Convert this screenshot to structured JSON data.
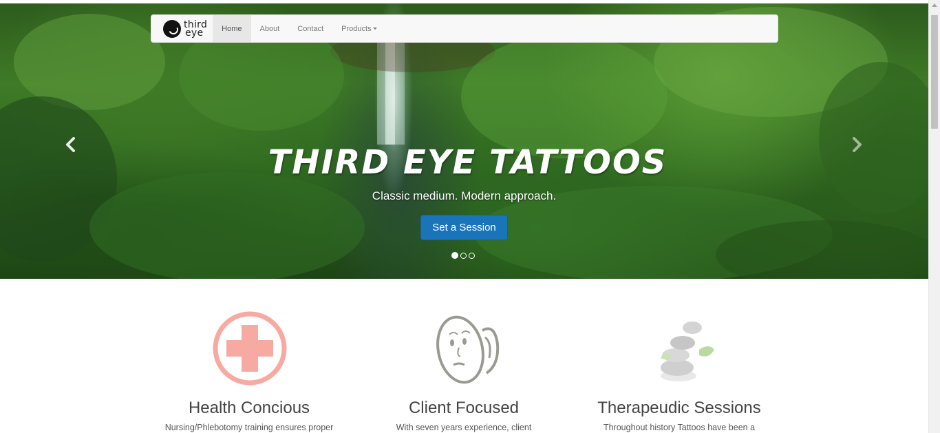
{
  "navbar": {
    "brand_line1": "third",
    "brand_line2": "eye",
    "items": [
      {
        "label": "Home",
        "active": true
      },
      {
        "label": "About",
        "active": false
      },
      {
        "label": "Contact",
        "active": false
      },
      {
        "label": "Products",
        "active": false,
        "dropdown": true
      }
    ]
  },
  "hero": {
    "title": "THIRD EYE TATTOOS",
    "subtitle": "Classic medium. Modern approach.",
    "cta_label": "Set a Session",
    "slides": 3,
    "active_slide": 1,
    "cta_color": "#1a74ba"
  },
  "features": [
    {
      "title": "Health Concious",
      "text": "Nursing/Phlebotomy training ensures proper",
      "icon": "medical-cross-icon"
    },
    {
      "title": "Client Focused",
      "text": "With seven years experience, client",
      "icon": "listening-face-icon"
    },
    {
      "title": "Therapeudic Sessions",
      "text": "Throughout history Tattoos have been a",
      "icon": "spa-stones-icon"
    }
  ]
}
